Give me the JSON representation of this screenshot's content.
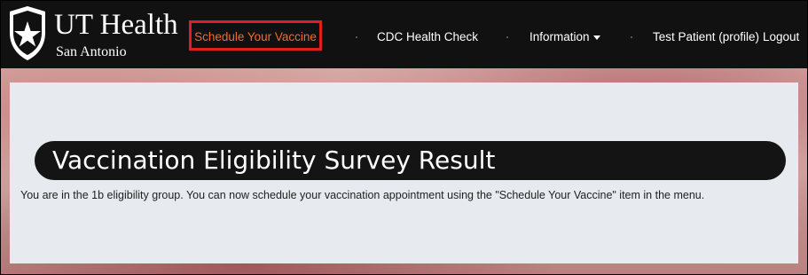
{
  "brand": {
    "name": "UT Health",
    "sub": "San Antonio"
  },
  "nav": {
    "schedule": "Schedule Your Vaccine",
    "cdc": "CDC Health Check",
    "information": "Information",
    "profile": "Test Patient (profile)",
    "logout": "Logout"
  },
  "content": {
    "title": "Vaccination Eligibility Survey Result",
    "message": "You are in the 1b eligibility group. You can now schedule your vaccination appointment using the \"Schedule Your Vaccine\" item in the menu."
  },
  "colors": {
    "navbar": "#111111",
    "active_link": "#f36b2b",
    "active_border": "#e02020",
    "panel": "#e7eaee",
    "title_pill": "#141414"
  }
}
